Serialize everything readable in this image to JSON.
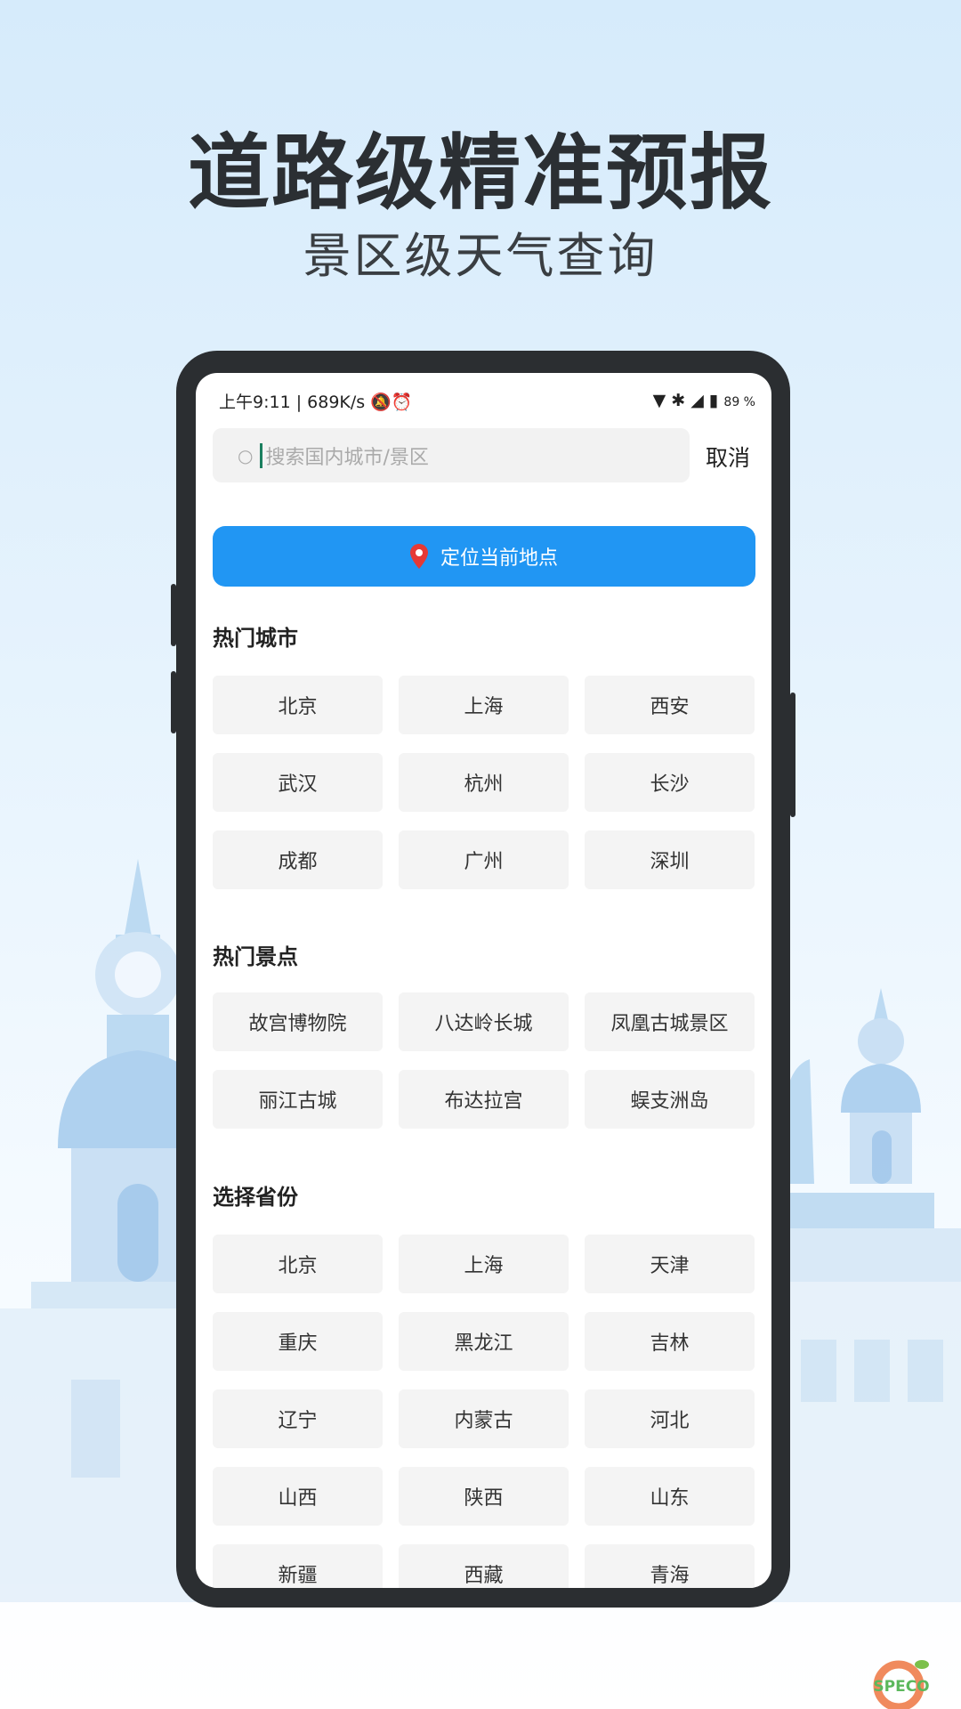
{
  "headline": "道路级精准预报",
  "subheadline": "景区级天气查询",
  "status_bar": {
    "left": "上午9:11 | 689K/s",
    "battery": "89 %"
  },
  "search": {
    "placeholder": "搜索国内城市/景区",
    "cancel_label": "取消"
  },
  "locate_label": "定位当前地点",
  "colors": {
    "accent": "#2196f3",
    "pin": "#e53935"
  },
  "hot_cities": {
    "title": "热门城市",
    "items": [
      "北京",
      "上海",
      "西安",
      "武汉",
      "杭州",
      "长沙",
      "成都",
      "广州",
      "深圳"
    ]
  },
  "hot_spots": {
    "title": "热门景点",
    "items": [
      "故宫博物院",
      "八达岭长城",
      "凤凰古城景区",
      "丽江古城",
      "布达拉宫",
      "蜈支洲岛"
    ]
  },
  "provinces": {
    "title": "选择省份",
    "items": [
      "北京",
      "上海",
      "天津",
      "重庆",
      "黑龙江",
      "吉林",
      "辽宁",
      "内蒙古",
      "河北",
      "山西",
      "陕西",
      "山东",
      "新疆",
      "西藏",
      "青海"
    ]
  },
  "watermark": "SPECO下载"
}
